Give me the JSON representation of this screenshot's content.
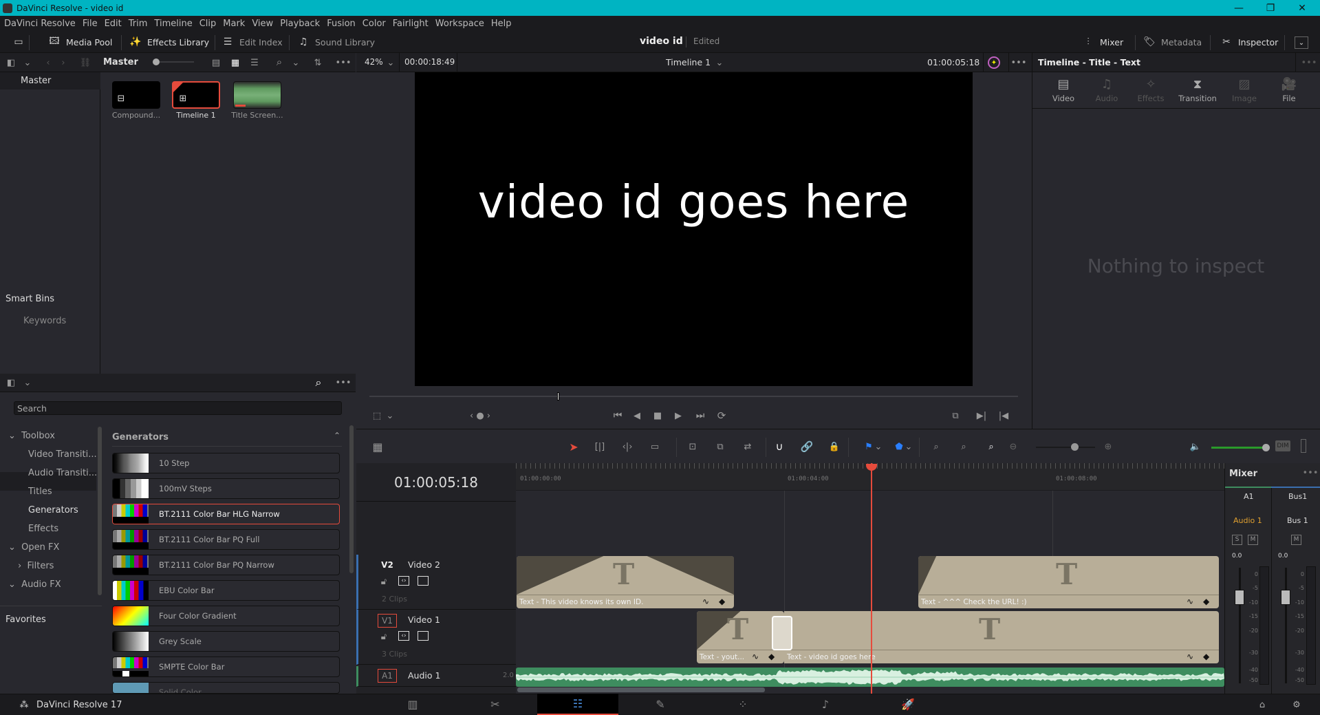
{
  "window": {
    "title": "DaVinci Resolve - video id"
  },
  "menu": [
    "DaVinci Resolve",
    "File",
    "Edit",
    "Trim",
    "Timeline",
    "Clip",
    "Mark",
    "View",
    "Playback",
    "Fusion",
    "Color",
    "Fairlight",
    "Workspace",
    "Help"
  ],
  "toolbar": {
    "media_pool": "Media Pool",
    "effects_library": "Effects Library",
    "edit_index": "Edit Index",
    "sound_library": "Sound Library",
    "mixer": "Mixer",
    "metadata": "Metadata",
    "inspector": "Inspector"
  },
  "project": {
    "name": "video id",
    "status": "Edited"
  },
  "media_pool": {
    "bin_header": "Master",
    "bins": [
      "Master"
    ],
    "smart_bins_label": "Smart Bins",
    "smart_bins": [
      "Keywords"
    ],
    "clips": [
      {
        "label": "Compound...",
        "selected": false
      },
      {
        "label": "Timeline 1",
        "selected": true
      },
      {
        "label": "Title Screen...",
        "selected": false
      }
    ]
  },
  "effects": {
    "search_placeholder": "Search",
    "tree": [
      {
        "label": "Toolbox",
        "expanded": true
      },
      {
        "label": "Video Transiti..."
      },
      {
        "label": "Audio Transiti..."
      },
      {
        "label": "Titles"
      },
      {
        "label": "Generators",
        "selected": true
      },
      {
        "label": "Effects"
      },
      {
        "label": "Open FX",
        "expanded": true
      },
      {
        "label": "Filters",
        "expanded": false
      },
      {
        "label": "Audio FX",
        "expanded": true
      }
    ],
    "favorites_label": "Favorites",
    "section_title": "Generators",
    "generators": [
      {
        "label": "10 Step"
      },
      {
        "label": "100mV Steps"
      },
      {
        "label": "BT.2111 Color Bar HLG Narrow",
        "selected": true
      },
      {
        "label": "BT.2111 Color Bar PQ Full"
      },
      {
        "label": "BT.2111 Color Bar PQ Narrow"
      },
      {
        "label": "EBU Color Bar"
      },
      {
        "label": "Four Color Gradient"
      },
      {
        "label": "Grey Scale"
      },
      {
        "label": "SMPTE Color Bar"
      },
      {
        "label": "Solid Color"
      }
    ]
  },
  "viewer": {
    "zoom": "42%",
    "duration": "00:00:18:49",
    "timeline_name": "Timeline 1",
    "timecode": "01:00:05:18",
    "frame_text": "video id goes here",
    "scrub_position": 0.29
  },
  "inspector": {
    "title": "Timeline - Title - Text",
    "tabs": [
      {
        "label": "Video",
        "enabled": true
      },
      {
        "label": "Audio",
        "enabled": false
      },
      {
        "label": "Effects",
        "enabled": false
      },
      {
        "label": "Transition",
        "enabled": true
      },
      {
        "label": "Image",
        "enabled": false
      },
      {
        "label": "File",
        "enabled": true
      }
    ],
    "empty_message": "Nothing to inspect"
  },
  "timeline": {
    "timecode": "01:00:05:18",
    "ruler": [
      "01:00:00:00",
      "01:00:04:00",
      "01:00:08:00"
    ],
    "tracks": [
      {
        "id": "V2",
        "name": "Video 2",
        "clips_count": "2 Clips"
      },
      {
        "id": "V1",
        "name": "Video 1",
        "clips_count": "3 Clips"
      },
      {
        "id": "A1",
        "name": "Audio 1",
        "channels": "2.0"
      }
    ],
    "clips": {
      "v2_a": "Text - This video knows its own ID.",
      "v2_b": "Text - ^^^ Check the URL! :)",
      "v1_a": "Text - yout...",
      "v1_b": "Text - video id goes here"
    },
    "zoom_level": 0.65,
    "volume_level": 1.0,
    "dim_label": "DIM"
  },
  "mixer": {
    "title": "Mixer",
    "channels": [
      {
        "id": "A1",
        "name": "Audio 1",
        "level": "0.0",
        "buttons": [
          "S",
          "M"
        ]
      },
      {
        "id": "Bus1",
        "name": "Bus 1",
        "level": "0.0",
        "buttons": [
          "M"
        ]
      }
    ],
    "scale": [
      "0",
      "-5",
      "-10",
      "-15",
      "-20",
      "-30",
      "-40",
      "-50"
    ]
  },
  "footer": {
    "app": "DaVinci Resolve 17"
  },
  "colors": {
    "accent": "#e64b3c",
    "titlebar": "#00b4c2",
    "audio_clip": "#3e8d5f",
    "title_clip": "#b8ae98"
  }
}
